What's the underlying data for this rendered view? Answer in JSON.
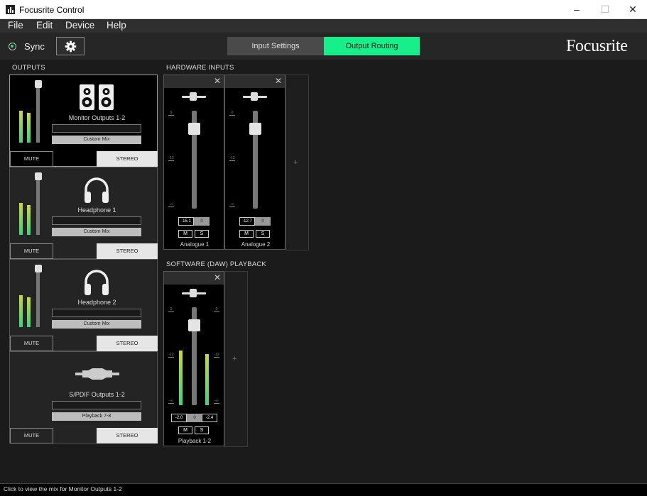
{
  "window": {
    "title": "Focusrite Control",
    "minimize_glyph": "–",
    "maximize_glyph": "☐",
    "close_glyph": "✕"
  },
  "menu": [
    "File",
    "Edit",
    "Device",
    "Help"
  ],
  "toolbar": {
    "sync_label": "Sync",
    "tabs": [
      {
        "label": "Input Settings",
        "active": false
      },
      {
        "label": "Output Routing",
        "active": true
      }
    ],
    "brand": "Focusrite",
    "accent_color": "#17f08a"
  },
  "outputs": {
    "title": "OUTPUTS",
    "items": [
      {
        "name": "Monitor Outputs 1-2",
        "mix": "Custom Mix",
        "mute": "MUTE",
        "stereo": "STEREO",
        "icon": "speakers-icon",
        "selected": true
      },
      {
        "name": "Headphone 1",
        "mix": "Custom Mix",
        "mute": "MUTE",
        "stereo": "STEREO",
        "icon": "headphones-icon",
        "selected": false
      },
      {
        "name": "Headphone 2",
        "mix": "Custom Mix",
        "mute": "MUTE",
        "stereo": "STEREO",
        "icon": "headphones-icon",
        "selected": false
      },
      {
        "name": "S/PDIF Outputs 1-2",
        "mix": "Playback 7-8",
        "mute": "MUTE",
        "stereo": "STEREO",
        "icon": "spdif-cable-icon",
        "selected": false
      }
    ]
  },
  "hardware_inputs": {
    "title": "HARDWARE INPUTS",
    "channels": [
      {
        "name": "Analogue 1",
        "gain": "-15.1",
        "pan": "0",
        "mute": "M",
        "solo": "S"
      },
      {
        "name": "Analogue 2",
        "gain": "-12.7",
        "pan": "0",
        "mute": "M",
        "solo": "S"
      }
    ],
    "add": "+"
  },
  "software_playback": {
    "title": "SOFTWARE (DAW) PLAYBACK",
    "channels": [
      {
        "name": "Playback 1-2",
        "gain_left": "-2.0",
        "pan": "0",
        "gain_right": "-2.4",
        "mute": "M",
        "solo": "S"
      }
    ],
    "add": "+"
  },
  "scale": {
    "top": "0",
    "mid": "-12",
    "bottom": "-∞"
  },
  "status": "Click to view the mix for Monitor Outputs 1-2"
}
